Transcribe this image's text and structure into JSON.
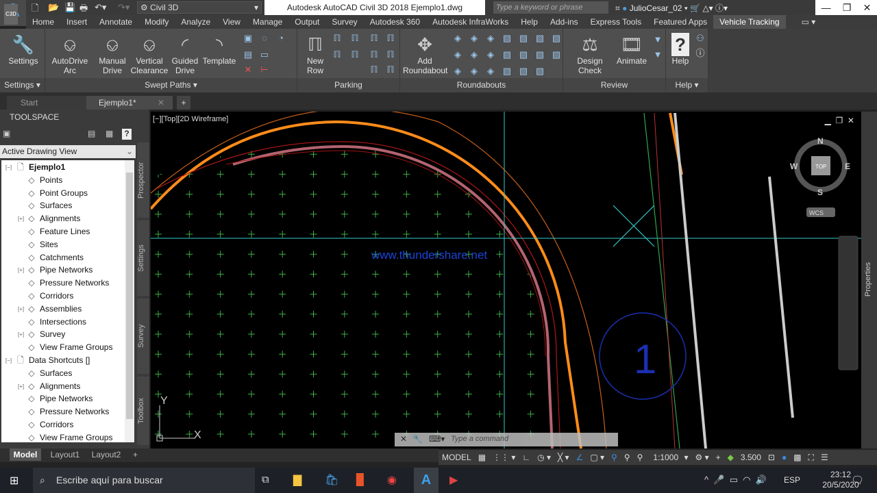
{
  "titlebar": {
    "app_badge": "C3D",
    "workspace": "Civil 3D",
    "title": "Autodesk AutoCAD Civil 3D 2018   Ejemplo1.dwg",
    "search_placeholder": "Type a keyword or phrase",
    "user": "JulioCesar_02"
  },
  "menu_tabs": [
    "Home",
    "Insert",
    "Annotate",
    "Modify",
    "Analyze",
    "View",
    "Manage",
    "Output",
    "Survey",
    "Autodesk 360",
    "Autodesk InfraWorks",
    "Help",
    "Add-ins",
    "Express Tools",
    "Featured Apps",
    "Vehicle Tracking"
  ],
  "active_tab": "Vehicle Tracking",
  "ribbon": {
    "settings": {
      "button": "Settings",
      "panel": "Settings"
    },
    "swept": {
      "buttons": [
        "AutoDrive Arc",
        "Manual Drive",
        "Vertical Clearance",
        "Guided Drive",
        "Template"
      ],
      "panel": "Swept Paths"
    },
    "parking": {
      "button": "New Row",
      "panel": "Parking"
    },
    "roundabouts": {
      "button": "Add Roundabout",
      "panel": "Roundabouts"
    },
    "review": {
      "buttons": [
        "Design Check",
        "Animate"
      ],
      "panel": "Review"
    },
    "help": {
      "button": "Help",
      "panel": "Help"
    }
  },
  "doc_tabs": [
    "Start",
    "Ejemplo1*"
  ],
  "toolspace": {
    "title": "TOOLSPACE",
    "view_select": "Active Drawing View",
    "side_tabs": [
      "Prospector",
      "Settings",
      "Survey",
      "Toolbox"
    ],
    "tree": [
      {
        "label": "Ejemplo1",
        "level": 0,
        "bold": true,
        "icon": "drawing-icon",
        "exp": "−"
      },
      {
        "label": "Points",
        "level": 1,
        "icon": "point-icon"
      },
      {
        "label": "Point Groups",
        "level": 1,
        "icon": "point-group-icon"
      },
      {
        "label": "Surfaces",
        "level": 1,
        "icon": "surface-icon"
      },
      {
        "label": "Alignments",
        "level": 1,
        "icon": "alignment-icon",
        "exp": "+"
      },
      {
        "label": "Feature Lines",
        "level": 1,
        "icon": "feature-line-icon"
      },
      {
        "label": "Sites",
        "level": 1,
        "icon": "site-icon"
      },
      {
        "label": "Catchments",
        "level": 1,
        "icon": "catchment-icon"
      },
      {
        "label": "Pipe Networks",
        "level": 1,
        "icon": "pipe-network-icon",
        "exp": "+"
      },
      {
        "label": "Pressure Networks",
        "level": 1,
        "icon": "pressure-network-icon"
      },
      {
        "label": "Corridors",
        "level": 1,
        "icon": "corridor-icon"
      },
      {
        "label": "Assemblies",
        "level": 1,
        "icon": "assembly-icon",
        "exp": "+"
      },
      {
        "label": "Intersections",
        "level": 1,
        "icon": "intersection-icon"
      },
      {
        "label": "Survey",
        "level": 1,
        "icon": "survey-icon",
        "exp": "+"
      },
      {
        "label": "View Frame Groups",
        "level": 1,
        "icon": "view-frame-icon"
      },
      {
        "label": "Data Shortcuts []",
        "level": 0,
        "icon": "shortcut-icon",
        "exp": "−"
      },
      {
        "label": "Surfaces",
        "level": 1,
        "icon": "surface-icon"
      },
      {
        "label": "Alignments",
        "level": 1,
        "icon": "alignment-icon",
        "exp": "+"
      },
      {
        "label": "Pipe Networks",
        "level": 1,
        "icon": "pipe-network-icon"
      },
      {
        "label": "Pressure Networks",
        "level": 1,
        "icon": "pressure-network-icon"
      },
      {
        "label": "Corridors",
        "level": 1,
        "icon": "corridor-icon"
      },
      {
        "label": "View Frame Groups",
        "level": 1,
        "icon": "view-frame-icon"
      }
    ]
  },
  "viewport": {
    "label": "[−][Top][2D Wireframe]",
    "watermark": "www.thundershare.net",
    "compass": {
      "n": "N",
      "s": "S",
      "e": "E",
      "w": "W",
      "top": "TOP",
      "wcs": "WCS"
    },
    "circle_label": "1",
    "ucs_x": "X",
    "ucs_y": "Y",
    "properties": "Properties"
  },
  "command": {
    "placeholder": "Type a command"
  },
  "layout_tabs": [
    "Model",
    "Layout1",
    "Layout2"
  ],
  "status": {
    "model": "MODEL",
    "scale": "1:1000",
    "value": "3.500"
  },
  "taskbar": {
    "search": "Escribe aquí para buscar",
    "lang": "ESP",
    "time": "23:12",
    "date": "20/5/2020"
  },
  "colors": {
    "accent": "#0078d7",
    "orange": "#ff8c00",
    "grid": "#3cb043",
    "cyan": "#3cc"
  }
}
